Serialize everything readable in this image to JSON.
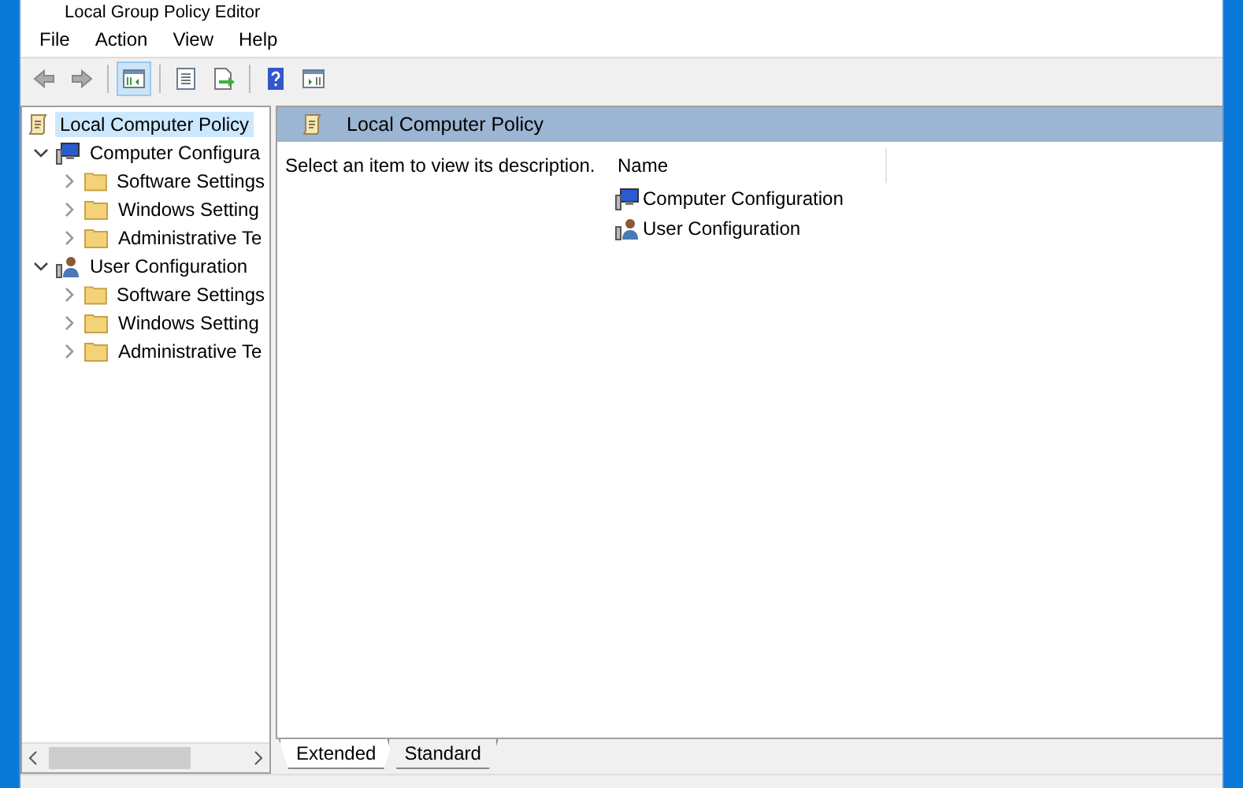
{
  "window": {
    "title": "Local Group Policy Editor"
  },
  "menu": [
    "File",
    "Action",
    "View",
    "Help"
  ],
  "toolbar": [
    {
      "kind": "back",
      "disabled": true,
      "selected": false
    },
    {
      "kind": "forward",
      "disabled": true,
      "selected": false
    },
    {
      "kind": "tree",
      "disabled": false,
      "selected": true
    },
    {
      "kind": "properties",
      "disabled": false,
      "selected": false
    },
    {
      "kind": "export",
      "disabled": false,
      "selected": false
    },
    {
      "kind": "help",
      "disabled": false,
      "selected": false
    },
    {
      "kind": "pane",
      "disabled": false,
      "selected": false
    }
  ],
  "tree": [
    {
      "label": "Local Computer Policy",
      "kind": "policy",
      "selected": true,
      "children": [
        {
          "label": "Computer Configura",
          "kind": "computer",
          "selected": false,
          "expanded": true,
          "children": [
            {
              "label": "Software Settings",
              "kind": "folder",
              "selected": false,
              "expanded": false
            },
            {
              "label": "Windows Setting",
              "kind": "folder",
              "selected": false,
              "expanded": false
            },
            {
              "label": "Administrative Te",
              "kind": "folder",
              "selected": false,
              "expanded": false
            }
          ]
        },
        {
          "label": "User Configuration",
          "kind": "user",
          "selected": false,
          "expanded": true,
          "children": [
            {
              "label": "Software Settings",
              "kind": "folder",
              "selected": false,
              "expanded": false
            },
            {
              "label": "Windows Setting",
              "kind": "folder",
              "selected": false,
              "expanded": false
            },
            {
              "label": "Administrative Te",
              "kind": "folder",
              "selected": false,
              "expanded": false
            }
          ]
        }
      ]
    }
  ],
  "details": {
    "title": "Local Computer Policy",
    "description": "Select an item to view its description.",
    "columns": [
      "Name"
    ],
    "rows": [
      {
        "name": "Computer Configuration",
        "kind": "computer"
      },
      {
        "name": "User Configuration",
        "kind": "user"
      }
    ]
  },
  "tabs": [
    {
      "label": "Extended",
      "selected": true
    },
    {
      "label": "Standard",
      "selected": false
    }
  ]
}
